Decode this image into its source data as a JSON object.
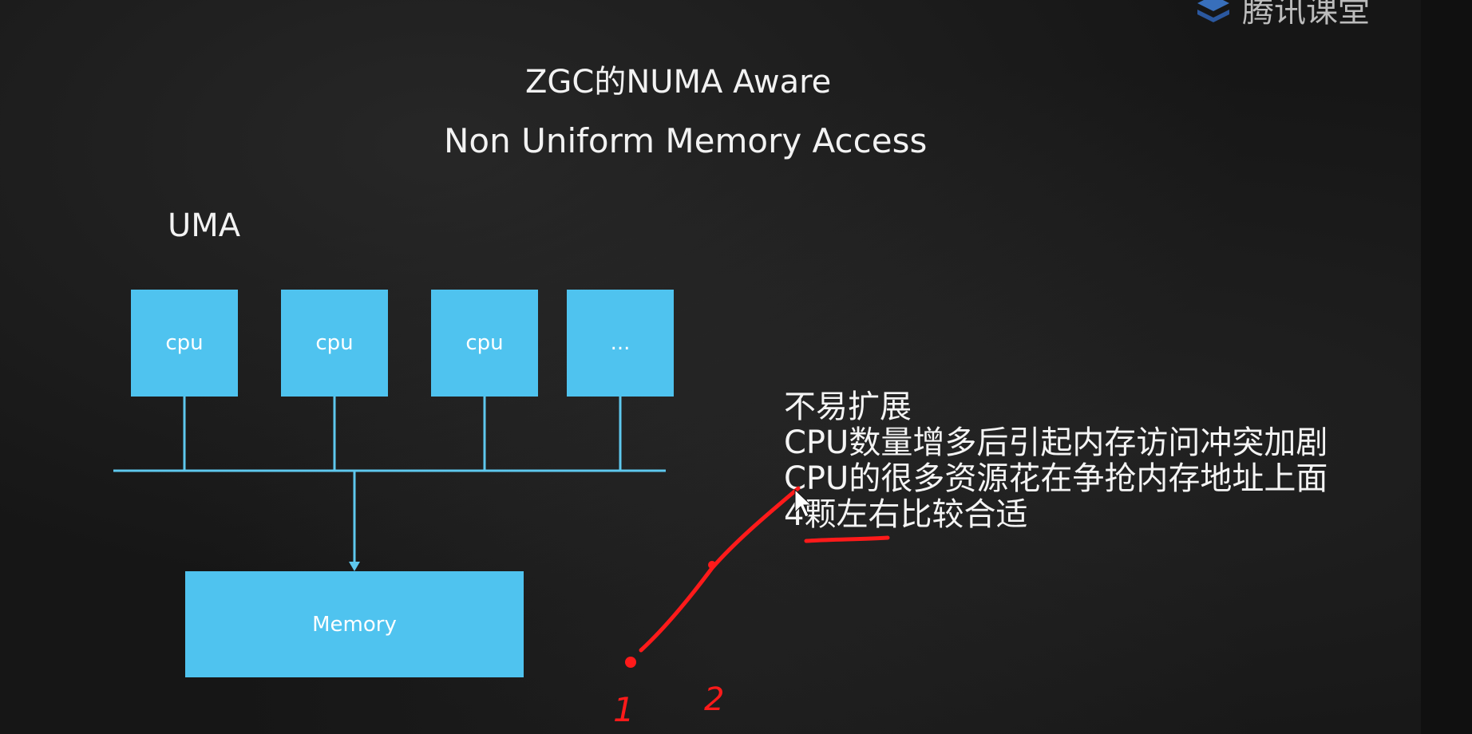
{
  "slide": {
    "title": "ZGC的NUMA Aware",
    "subtitle": "Non Uniform Memory Access",
    "section_label": "UMA"
  },
  "diagram": {
    "cpu_boxes": [
      "cpu",
      "cpu",
      "cpu",
      "..."
    ],
    "memory_label": "Memory",
    "box_color": "#4fc3ef",
    "line_color": "#5ec8ee"
  },
  "notes": [
    "不易扩展",
    "CPU数量增多后引起内存访问冲突加剧",
    "CPU的很多资源花在争抢内存地址上面",
    "4颗左右比较合适"
  ],
  "annotations": {
    "handwritten_numbers": [
      "1",
      "2"
    ],
    "ink_color": "#ff1a1a"
  },
  "watermark": {
    "text": "腾讯课堂"
  }
}
